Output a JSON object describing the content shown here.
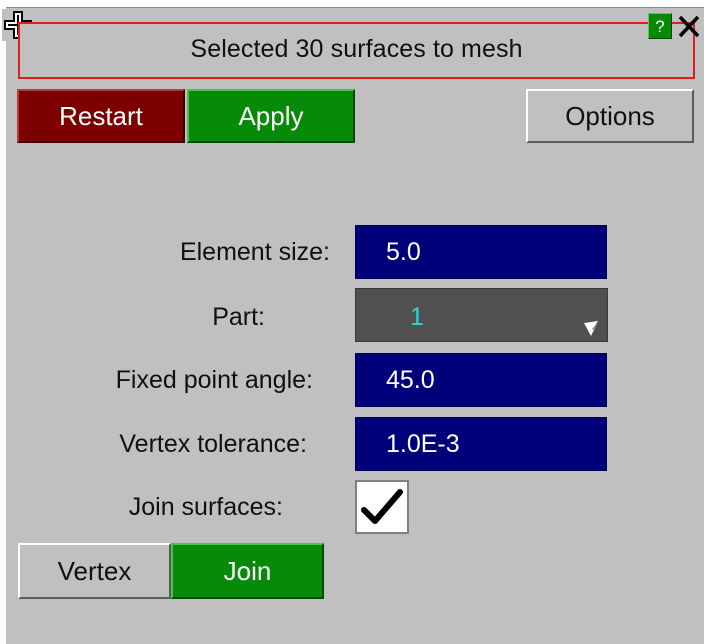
{
  "panel": {
    "title": "Selected 30 surfaces to mesh",
    "help_label": "?",
    "accent_color": "#e11e1e"
  },
  "toolbar": {
    "restart_label": "Restart",
    "apply_label": "Apply",
    "options_label": "Options"
  },
  "form": {
    "element_size": {
      "label": "Element size:",
      "value": "5.0"
    },
    "part": {
      "label": "Part:",
      "value": "1"
    },
    "fixed_point_angle": {
      "label": "Fixed point angle:",
      "value": "45.0"
    },
    "vertex_tolerance": {
      "label": "Vertex tolerance:",
      "value": "1.0E-3"
    },
    "join_surfaces": {
      "label": "Join surfaces:",
      "checked": true
    }
  },
  "mode_tabs": {
    "vertex_label": "Vertex",
    "join_label": "Join",
    "active": "Join"
  },
  "icons": {
    "move": "move-icon",
    "close": "close-icon",
    "dropdown": "dropdown-arrow-icon",
    "check": "checkmark-icon"
  }
}
